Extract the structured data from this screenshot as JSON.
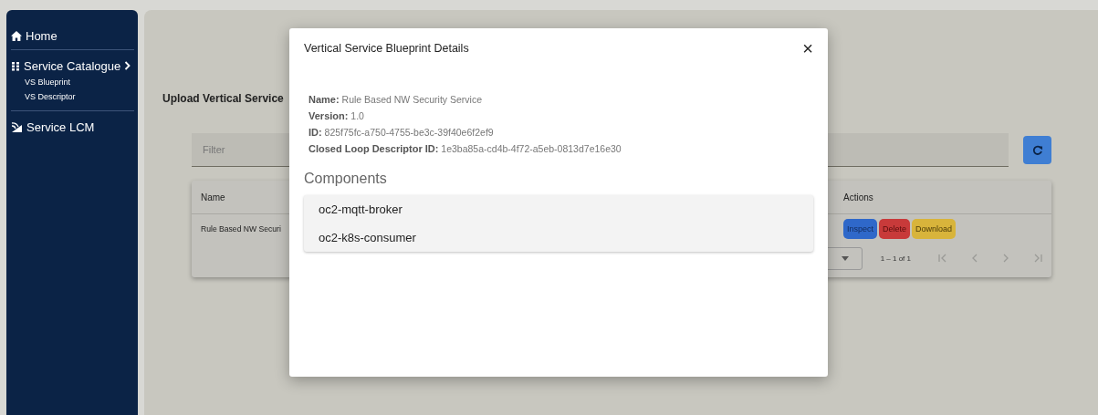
{
  "sidebar": {
    "items": [
      {
        "kind": "home",
        "label": "Home"
      },
      {
        "kind": "catalogue",
        "label": "Service Catalogue",
        "expanded": true,
        "children": [
          {
            "label": "VS Blueprint"
          },
          {
            "label": "VS Descriptor"
          }
        ]
      },
      {
        "kind": "lcm",
        "label": "Service LCM"
      }
    ]
  },
  "page": {
    "title": "Upload Vertical Service",
    "filter": {
      "placeholder": "Filter"
    },
    "table": {
      "columns": [
        "Name",
        "Actions"
      ],
      "rows": [
        {
          "name": "Rule Based NW Securi",
          "actions": [
            {
              "kind": "inspect",
              "label": "Inspect"
            },
            {
              "kind": "delete",
              "label": "Delete"
            },
            {
              "kind": "download",
              "label": "Download"
            }
          ]
        }
      ],
      "pagination": {
        "range": "1 – 1 of 1"
      }
    }
  },
  "modal": {
    "title": "Vertical Service Blueprint Details",
    "close": "×",
    "details": [
      {
        "label": "Name:",
        "value": "Rule Based NW Security Service"
      },
      {
        "label": "Version:",
        "value": "1.0"
      },
      {
        "label": "ID:",
        "value": "825f75fc-a750-4755-be3c-39f40e6f2ef9"
      },
      {
        "label": "Closed Loop Descriptor ID:",
        "value": "1e3ba85a-cd4b-4f72-a5eb-0813d7e16e30"
      }
    ],
    "components_heading": "Components",
    "components": [
      "oc2-mqtt-broker",
      "oc2-k8s-consumer"
    ]
  }
}
